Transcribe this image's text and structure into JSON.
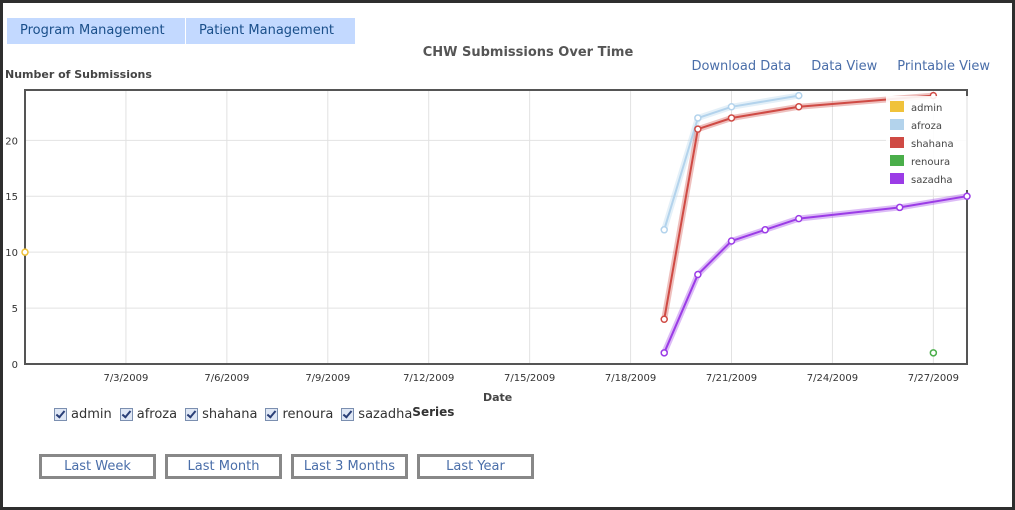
{
  "tabs": [
    "Program Management",
    "Patient Management"
  ],
  "links": {
    "download": "Download Data",
    "data_view": "Data View",
    "printable": "Printable View"
  },
  "checkboxes": [
    {
      "label": "admin",
      "checked": true
    },
    {
      "label": "afroza",
      "checked": true
    },
    {
      "label": "shahana",
      "checked": true
    },
    {
      "label": "renoura",
      "checked": true
    },
    {
      "label": "sazadha",
      "checked": true
    }
  ],
  "series_label": "Series",
  "buttons": [
    "Last Week",
    "Last Month",
    "Last 3 Months",
    "Last Year"
  ],
  "chart_data": {
    "type": "line",
    "title": "CHW Submissions Over Time",
    "ylabel": "Number of Submissions",
    "xlabel": "Date",
    "x_ticks": [
      "7/3/2009",
      "7/6/2009",
      "7/9/2009",
      "7/12/2009",
      "7/15/2009",
      "7/18/2009",
      "7/21/2009",
      "7/24/2009",
      "7/27/2009"
    ],
    "y_ticks": [
      0,
      5,
      10,
      15,
      20
    ],
    "xlim": [
      "2009-06-30",
      "2009-07-28"
    ],
    "ylim": [
      0,
      24.5
    ],
    "grid": true,
    "legend": "top-right",
    "series": [
      {
        "name": "admin",
        "color": "#f0c23a",
        "points": [
          [
            "2009-06-30",
            10
          ]
        ]
      },
      {
        "name": "afroza",
        "color": "#b3d3ec",
        "points": [
          [
            "2009-07-19",
            12
          ],
          [
            "2009-07-20",
            22
          ],
          [
            "2009-07-21",
            23
          ],
          [
            "2009-07-23",
            24
          ]
        ]
      },
      {
        "name": "shahana",
        "color": "#cf4a44",
        "points": [
          [
            "2009-07-19",
            4
          ],
          [
            "2009-07-20",
            21
          ],
          [
            "2009-07-21",
            22
          ],
          [
            "2009-07-23",
            23
          ],
          [
            "2009-07-27",
            24
          ]
        ]
      },
      {
        "name": "renoura",
        "color": "#4aae4a",
        "points": [
          [
            "2009-07-27",
            1
          ]
        ]
      },
      {
        "name": "sazadha",
        "color": "#9b3ce6",
        "points": [
          [
            "2009-07-19",
            1
          ],
          [
            "2009-07-20",
            8
          ],
          [
            "2009-07-21",
            11
          ],
          [
            "2009-07-22",
            12
          ],
          [
            "2009-07-23",
            13
          ],
          [
            "2009-07-26",
            14
          ],
          [
            "2009-07-28",
            15
          ]
        ]
      }
    ]
  }
}
